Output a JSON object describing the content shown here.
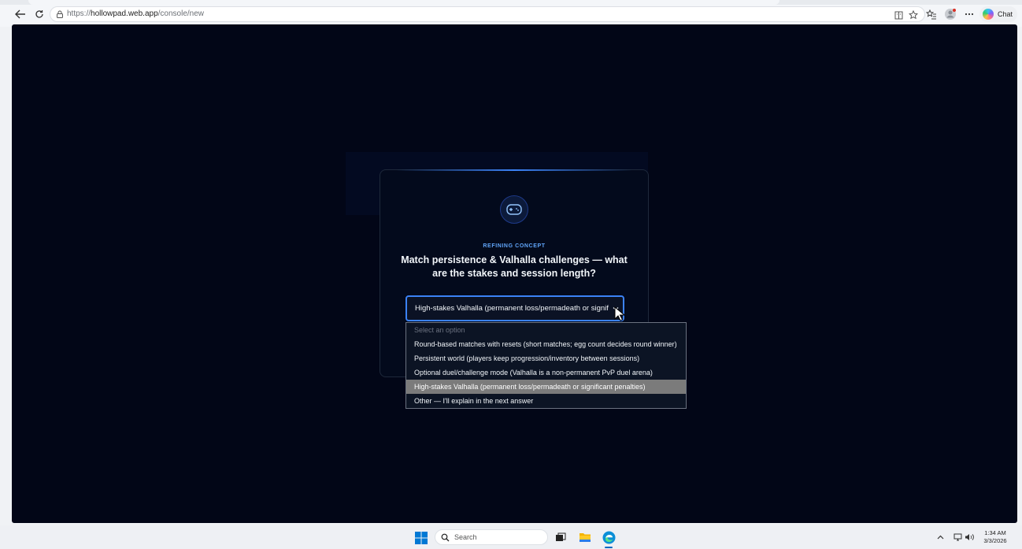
{
  "browser": {
    "url_scheme": "https://",
    "url_host": "hollowpad.web.app",
    "url_path": "/console/new",
    "chat_label": "Chat"
  },
  "page": {
    "eyebrow": "REFINING CONCEPT",
    "question": "Match persistence & Valhalla challenges — what are the stakes and session length?",
    "select": {
      "value": "High-stakes Valhalla (permanent loss/permadeath or significant penalties)",
      "placeholder": "Select an option",
      "options": [
        "Round-based matches with resets (short matches; egg count decides round winner)",
        "Persistent world (players keep progression/inventory between sessions)",
        "Optional duel/challenge mode (Valhalla is a non-permanent PvP duel arena)",
        "High-stakes Valhalla (permanent loss/permadeath or significant penalties)",
        "Other — I'll explain in the next answer"
      ],
      "selected_index": 3
    },
    "colors": {
      "background": "#020617",
      "accent": "#3b82f6",
      "eyebrow": "#60a5fa"
    }
  },
  "taskbar": {
    "search_placeholder": "Search",
    "time": "1:34 AM",
    "date": "3/3/2026"
  }
}
